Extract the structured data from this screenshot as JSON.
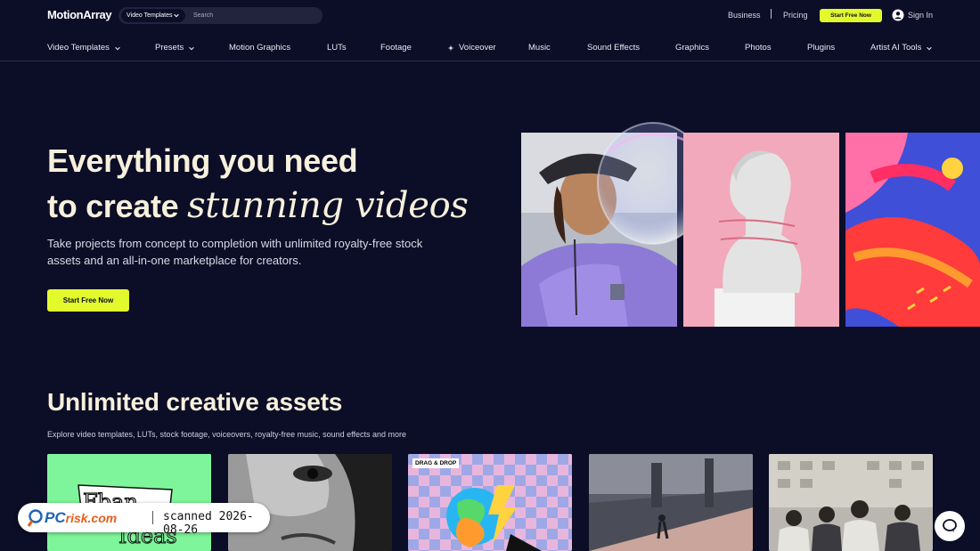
{
  "header": {
    "logo": "MotionArray",
    "search": {
      "category": "Video Templates",
      "placeholder": "Search"
    },
    "links": {
      "business": "Business",
      "pricing": "Pricing",
      "sign_in": "Sign In"
    },
    "cta_label": "Start Free Now"
  },
  "nav": {
    "items": [
      {
        "label": "Video Templates",
        "dropdown": true
      },
      {
        "label": "Presets",
        "dropdown": true
      },
      {
        "label": "Motion Graphics",
        "dropdown": false
      },
      {
        "label": "LUTs",
        "dropdown": false
      },
      {
        "label": "Footage",
        "dropdown": false
      },
      {
        "label": "Voiceover",
        "dropdown": false,
        "icon": "sparkle-icon"
      },
      {
        "label": "Music",
        "dropdown": false
      },
      {
        "label": "Sound Effects",
        "dropdown": false
      },
      {
        "label": "Graphics",
        "dropdown": false
      },
      {
        "label": "Photos",
        "dropdown": false
      },
      {
        "label": "Plugins",
        "dropdown": false
      },
      {
        "label": "Artist AI Tools",
        "dropdown": true
      }
    ]
  },
  "hero": {
    "title_line1": "Everything you need",
    "title_line2_prefix": "to create ",
    "title_line2_script": "stunning videos",
    "subtitle": "Take projects from concept to completion with unlimited royalty-free stock assets and an all-in-one marketplace for creators.",
    "cta_label": "Start Free Now",
    "media_panels": [
      "person-with-hat-photo",
      "statue-bust-photo",
      "colorful-abstract-art"
    ]
  },
  "assets": {
    "title": "Unlimited creative assets",
    "subtitle": "Explore video templates, LUTs, stock footage, voiceovers, royalty-free music, sound effects and more",
    "cards": [
      {
        "image": "green-typography-card",
        "text": "Ideas"
      },
      {
        "image": "bw-face-closeup-card"
      },
      {
        "image": "drag-and-drop-checkered-card",
        "badge": "DRAG & DROP"
      },
      {
        "image": "skateboarder-street-card"
      },
      {
        "image": "group-of-friends-card"
      }
    ]
  },
  "watermark": {
    "brand_pc": "PC",
    "brand_risk": "risk.com",
    "stamp": "scanned 2026-08-26"
  },
  "colors": {
    "background": "#0c0d26",
    "accent": "#e2fa2c",
    "heading": "#f6f0dc",
    "watermark_blue": "#1e63b6",
    "watermark_orange": "#e85d17"
  },
  "icons": {
    "user": "user-icon",
    "chevron": "chevron-down-icon",
    "chat": "chat-icon"
  }
}
